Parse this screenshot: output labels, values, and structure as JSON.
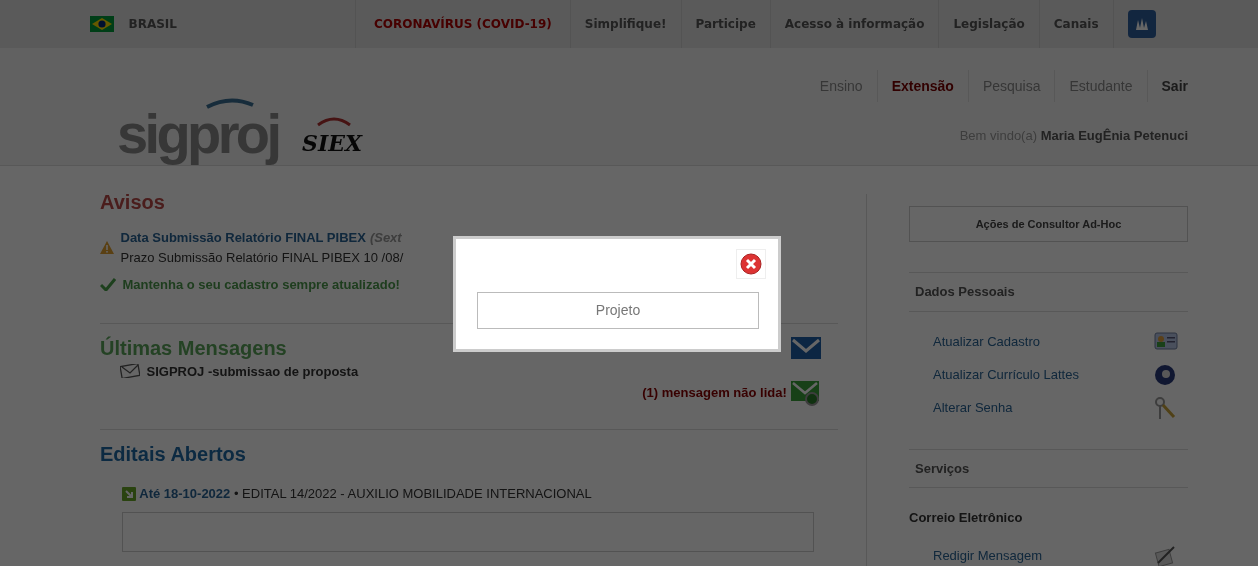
{
  "gov_bar": {
    "country": "BRASIL",
    "links": [
      {
        "label": "CORONAVÍRUS (COVID-19)",
        "kind": "alert"
      },
      {
        "label": "Simplifique!",
        "kind": "normal"
      },
      {
        "label": "Participe",
        "kind": "normal"
      },
      {
        "label": "Acesso à informação",
        "kind": "normal"
      },
      {
        "label": "Legislação",
        "kind": "normal"
      },
      {
        "label": "Canais",
        "kind": "normal"
      }
    ]
  },
  "header": {
    "logo": {
      "text": "sigproj",
      "sub": "SIEX"
    },
    "nav": [
      {
        "label": "Ensino",
        "selected": false,
        "kind": "link"
      },
      {
        "label": "Extensão",
        "selected": true,
        "kind": "link"
      },
      {
        "label": "Pesquisa",
        "selected": false,
        "kind": "link"
      },
      {
        "label": "Estudante",
        "selected": false,
        "kind": "link"
      },
      {
        "label": "Sair",
        "selected": false,
        "kind": "logout"
      }
    ],
    "welcome": {
      "prefix": "Bem vindo(a)",
      "name": "Maria EugÊnia Petenuci"
    }
  },
  "avisos": {
    "title": "Avisos",
    "items": [
      {
        "kind": "warning",
        "title": "Data Submissão Relatório FINAL PIBEX",
        "note": "(Sext",
        "text": "Prazo Submissão Relatório FINAL PIBEX 10 /08/"
      },
      {
        "kind": "ok",
        "text": "Mantenha o seu cadastro sempre atualizado!"
      }
    ]
  },
  "mensagens": {
    "title": "Últimas Mensagens",
    "items": [
      {
        "subject": "SIGPROJ -submissao de proposta"
      }
    ],
    "unread": "(1) mensagem não lida!"
  },
  "editais": {
    "title": "Editais Abertos",
    "items": [
      {
        "date": "Até 18-10-2022",
        "separator": "•",
        "title": "EDITAL 14/2022 - AUXILIO MOBILIDADE INTERNACIONAL"
      }
    ]
  },
  "sidebar": {
    "consultor_button": "Ações de Consultor Ad-Hoc",
    "sections": [
      {
        "title": "Dados Pessoais",
        "kind": "boxed",
        "links": [
          "Atualizar Cadastro",
          "Atualizar Currículo Lattes",
          "Alterar Senha"
        ]
      },
      {
        "title": "Serviços",
        "kind": "boxed"
      },
      {
        "title": "Correio Eletrônico",
        "kind": "plain",
        "links": [
          "Redigir Mensagem"
        ]
      }
    ]
  },
  "modal": {
    "button": "Projeto"
  }
}
